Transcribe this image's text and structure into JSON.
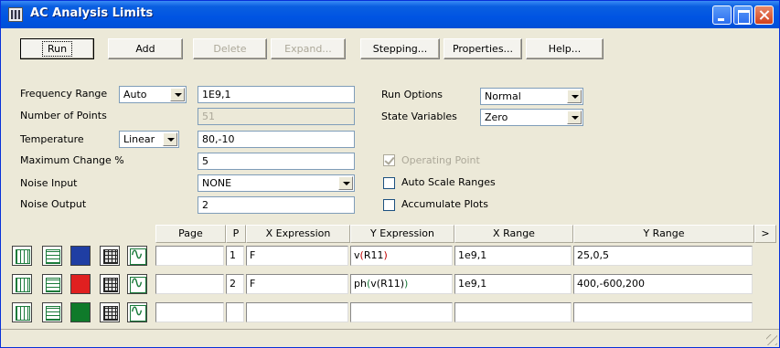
{
  "window": {
    "title": "AC Analysis Limits"
  },
  "toolbar": {
    "run": "Run",
    "add": "Add",
    "delete": "Delete",
    "expand": "Expand...",
    "stepping": "Stepping...",
    "properties": "Properties...",
    "help": "Help..."
  },
  "form": {
    "frequency_range": {
      "label": "Frequency Range",
      "mode": "Auto",
      "value": "1E9,1"
    },
    "number_of_points": {
      "label": "Number of Points",
      "value": "51"
    },
    "temperature": {
      "label": "Temperature",
      "mode": "Linear",
      "value": "80,-10"
    },
    "maximum_change": {
      "label": "Maximum Change %",
      "value": "5"
    },
    "noise_input": {
      "label": "Noise Input",
      "value": "NONE"
    },
    "noise_output": {
      "label": "Noise Output",
      "value": "2"
    },
    "run_options": {
      "label": "Run Options",
      "value": "Normal"
    },
    "state_variables": {
      "label": "State Variables",
      "value": "Zero"
    },
    "operating_point": {
      "label": "Operating Point",
      "checked": true,
      "disabled": true
    },
    "auto_scale_ranges": {
      "label": "Auto Scale Ranges",
      "checked": false
    },
    "accumulate_plots": {
      "label": "Accumulate Plots",
      "checked": false
    }
  },
  "grid": {
    "headers": {
      "page": "Page",
      "p": "P",
      "x_expr": "X Expression",
      "y_expr": "Y Expression",
      "x_range": "X Range",
      "y_range": "Y Range",
      "more": ">"
    },
    "rows": [
      {
        "color": "#1f3ea3",
        "page": "",
        "p": "1",
        "x_expr": "F",
        "y_fn": "v",
        "y_open": "(",
        "y_arg": "R11",
        "y_close": ")",
        "y_rest": "",
        "x_range": "1e9,1",
        "y_range": "25,0,5"
      },
      {
        "color": "#e02020",
        "page": "",
        "p": "2",
        "x_expr": "F",
        "y_fn": "ph",
        "y_open": "(",
        "y_arg": "v(R11)",
        "y_close": ")",
        "y_rest": "",
        "x_range": "1e9,1",
        "y_range": "400,-600,200"
      },
      {
        "color": "#0f7a2a",
        "page": "",
        "p": "",
        "x_expr": "",
        "y_fn": "",
        "y_open": "",
        "y_arg": "",
        "y_close": "",
        "y_rest": "",
        "x_range": "",
        "y_range": ""
      }
    ]
  },
  "icons": [
    "table-columns-icon",
    "table-rows-icon",
    "color-swatch-icon",
    "grid-icon",
    "waveform-icon"
  ]
}
